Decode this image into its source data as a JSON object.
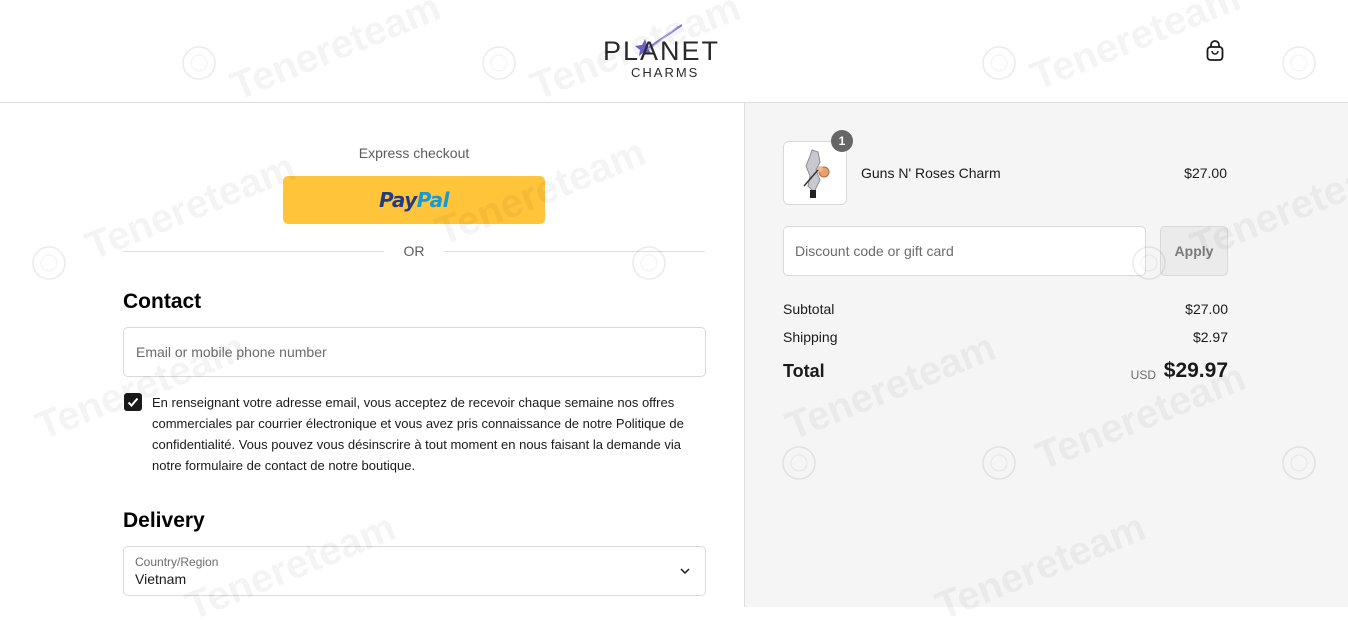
{
  "header": {
    "logo_top": "PLANET",
    "logo_bottom": "CHARMS",
    "cart_icon": "shopping-bag-icon"
  },
  "express": {
    "label": "Express checkout",
    "paypal_pay": "Pay",
    "paypal_pal": "Pal",
    "or_label": "OR"
  },
  "contact": {
    "heading": "Contact",
    "email_placeholder": "Email or mobile phone number",
    "consent_checked": true,
    "consent_text": "En renseignant votre adresse email, vous acceptez de recevoir chaque semaine nos offres commerciales par courrier électronique et vous avez pris connaissance de notre Politique de confidentialité. Vous pouvez vous désinscrire à tout moment en nous faisant la demande via notre formulaire de contact de notre boutique."
  },
  "delivery": {
    "heading": "Delivery",
    "country_label": "Country/Region",
    "country_value": "Vietnam"
  },
  "order": {
    "item": {
      "quantity": "1",
      "name": "Guns N' Roses Charm",
      "price": "$27.00"
    },
    "discount_placeholder": "Discount code or gift card",
    "apply_label": "Apply",
    "subtotal_label": "Subtotal",
    "subtotal_value": "$27.00",
    "shipping_label": "Shipping",
    "shipping_value": "$2.97",
    "total_label": "Total",
    "total_currency": "USD",
    "total_value": "$29.97"
  },
  "watermark": {
    "text": "Tenereteam"
  },
  "colors": {
    "paypal_button": "#ffc43a",
    "paypal_dark": "#253b80",
    "paypal_light": "#179bd7",
    "summary_bg": "#f5f5f5",
    "checkbox": "#1a1a1a"
  }
}
